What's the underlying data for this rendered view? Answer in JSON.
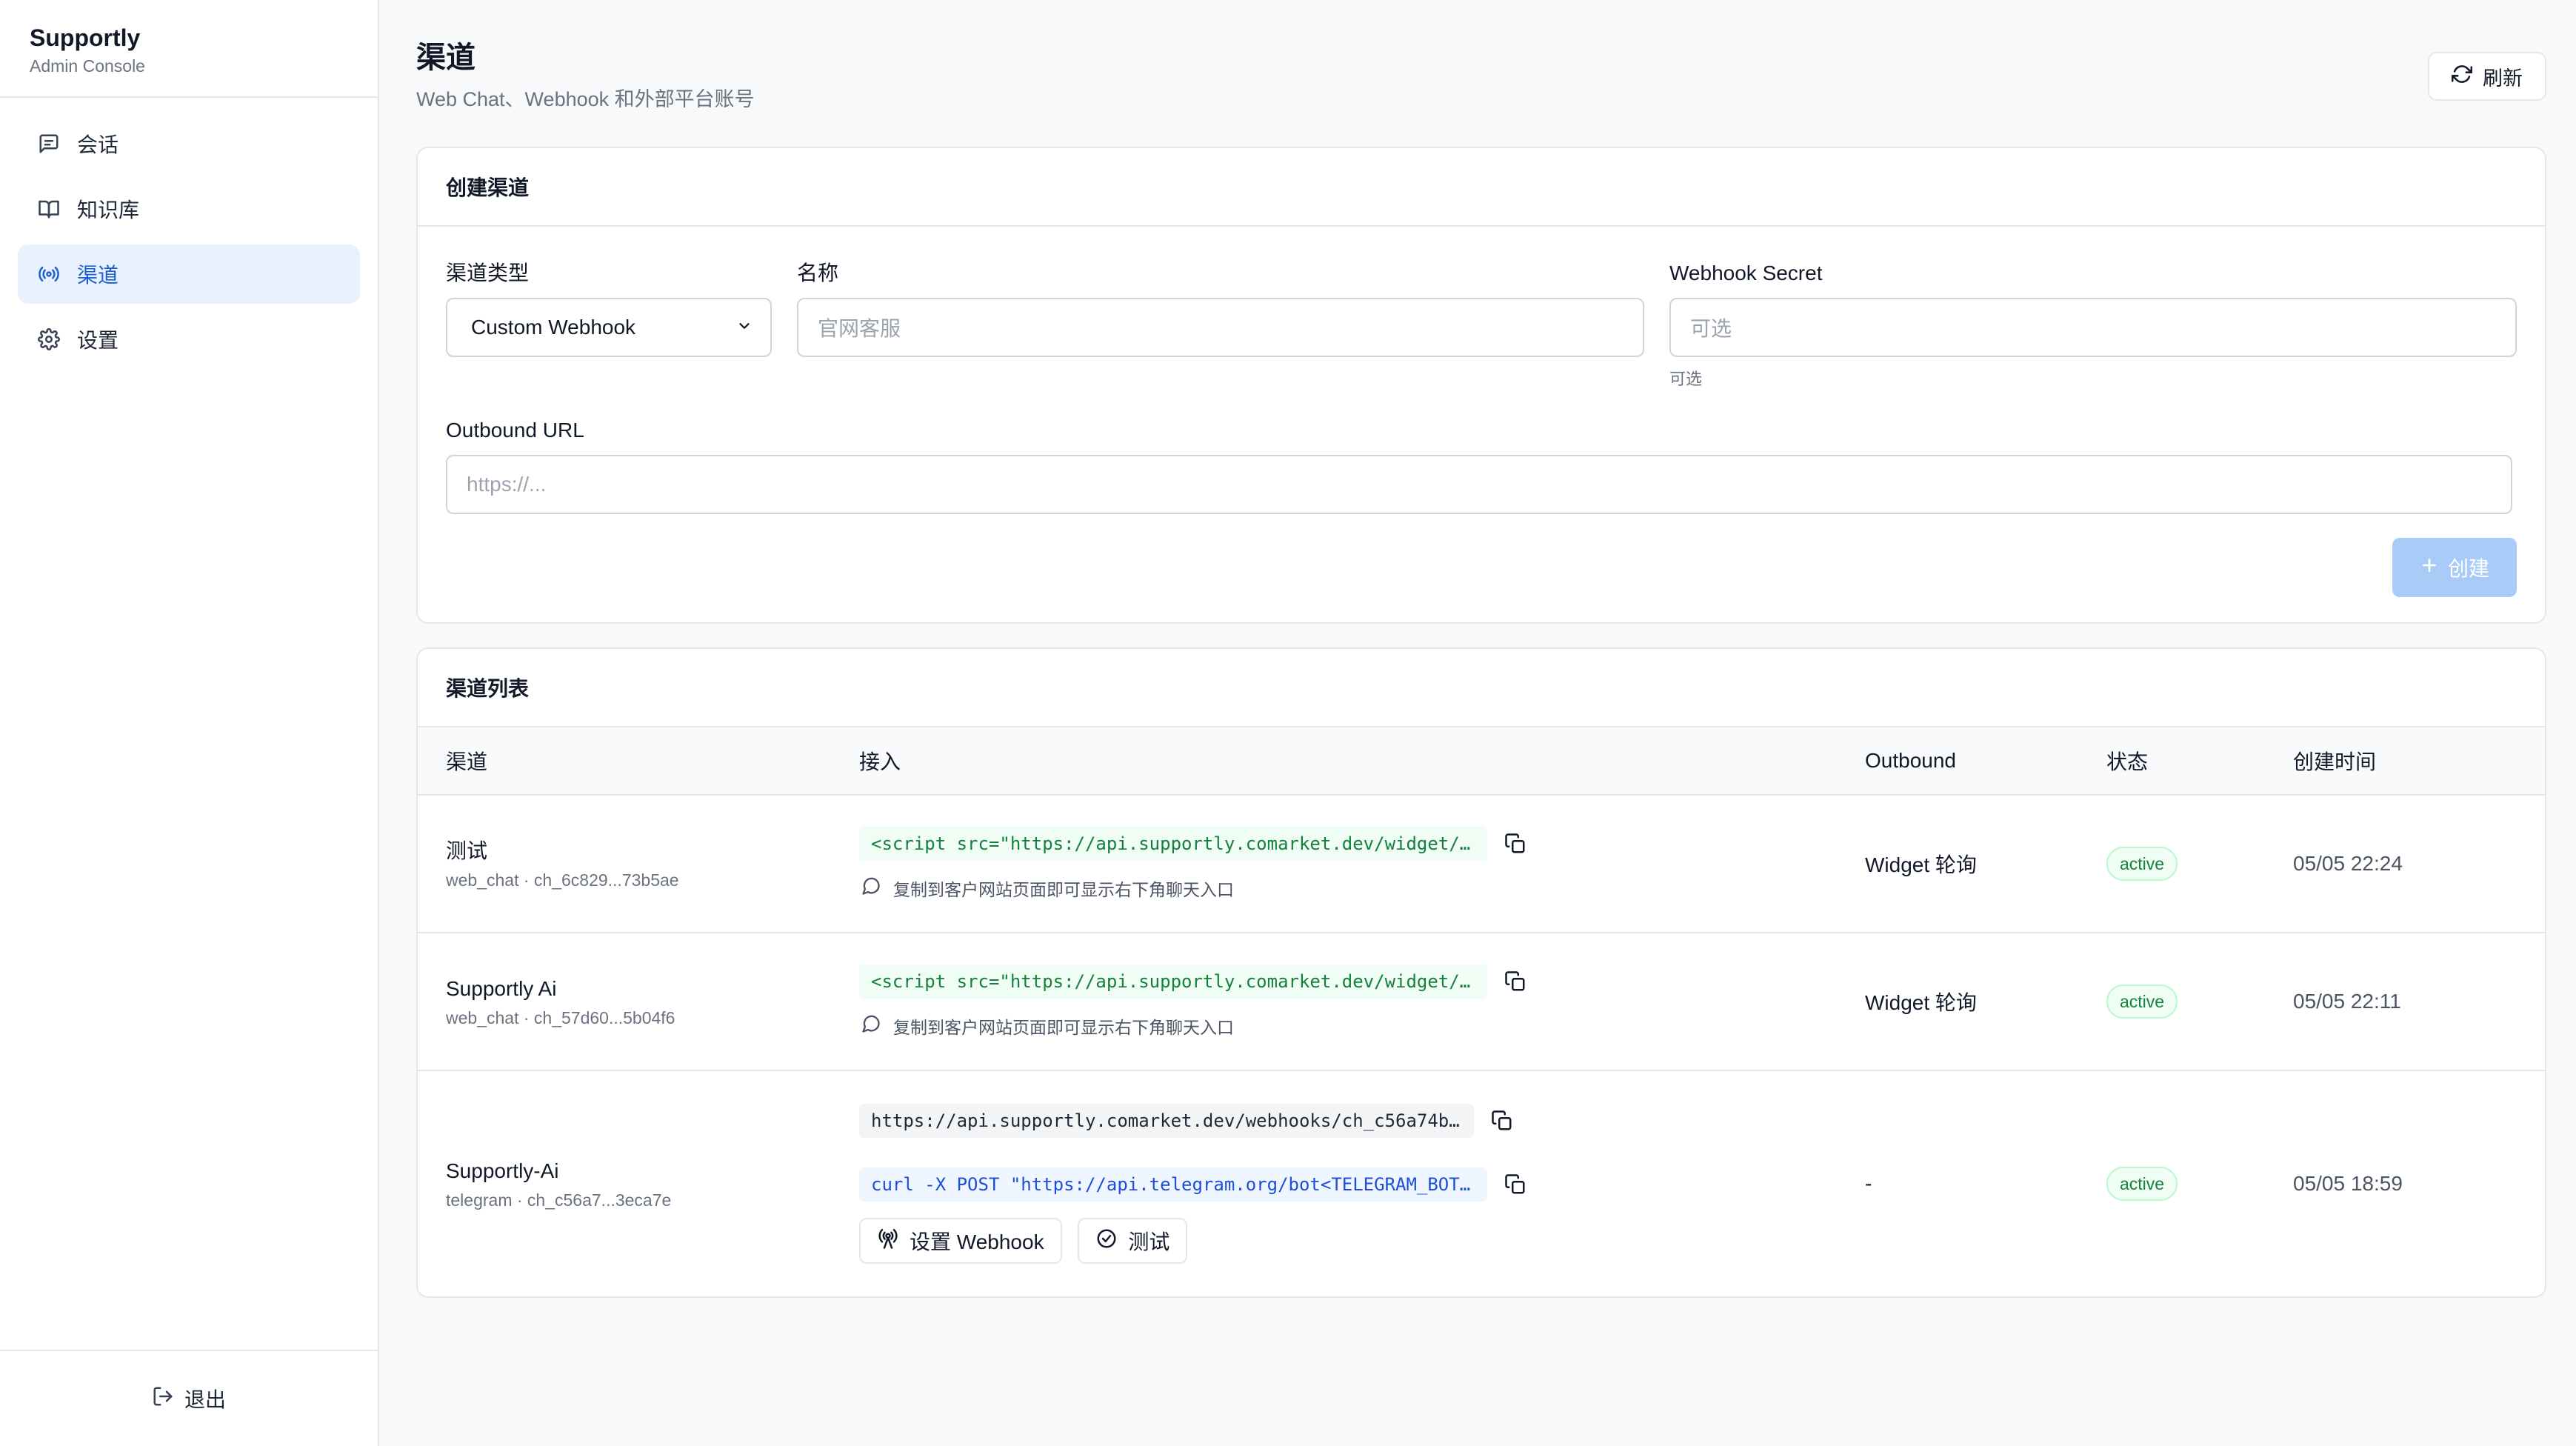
{
  "sidebar": {
    "brand_name": "Supportly",
    "brand_sub": "Admin Console",
    "items": [
      {
        "label": "会话",
        "icon": "message-icon"
      },
      {
        "label": "知识库",
        "icon": "book-icon"
      },
      {
        "label": "渠道",
        "icon": "radio-icon",
        "active": true
      },
      {
        "label": "设置",
        "icon": "gear-icon"
      }
    ],
    "logout_label": "退出"
  },
  "header": {
    "title": "渠道",
    "subtitle": "Web Chat、Webhook 和外部平台账号",
    "refresh_label": "刷新"
  },
  "create": {
    "title": "创建渠道",
    "type_label": "渠道类型",
    "type_value": "Custom Webhook",
    "name_label": "名称",
    "name_placeholder": "官网客服",
    "secret_label": "Webhook Secret",
    "secret_placeholder": "可选",
    "secret_hint": "可选",
    "outbound_label": "Outbound URL",
    "outbound_placeholder": "https://...",
    "create_label": "创建"
  },
  "list": {
    "title": "渠道列表",
    "columns": [
      "渠道",
      "接入",
      "Outbound",
      "状态",
      "创建时间"
    ],
    "rows": [
      {
        "name": "测试",
        "meta": "web_chat · ch_6c829...73b5ae",
        "code": "<script src=\"https://api.supportly.comarket.dev/widget/…",
        "note": "复制到客户网站页面即可显示右下角聊天入口",
        "outbound": "Widget 轮询",
        "status": "active",
        "created": "05/05 22:24"
      },
      {
        "name": "Supportly Ai",
        "meta": "web_chat · ch_57d60...5b04f6",
        "code": "<script src=\"https://api.supportly.comarket.dev/widget/…",
        "note": "复制到客户网站页面即可显示右下角聊天入口",
        "outbound": "Widget 轮询",
        "status": "active",
        "created": "05/05 22:11"
      },
      {
        "name": "Supportly-Ai",
        "meta": "telegram · ch_c56a7...3eca7e",
        "webhook": "https://api.supportly.comarket.dev/webhooks/ch_c56a74b…",
        "curl": "curl -X POST \"https://api.telegram.org/bot<TELEGRAM_BOT…",
        "set_webhook_label": "设置 Webhook",
        "test_label": "测试",
        "outbound": "-",
        "status": "active",
        "created": "05/05 18:59"
      }
    ]
  },
  "colors": {
    "accent": "#1d5fd0",
    "active_nav_bg": "#e8f1fe",
    "create_button": "#a8cbf7",
    "status_green": "#15803d"
  }
}
